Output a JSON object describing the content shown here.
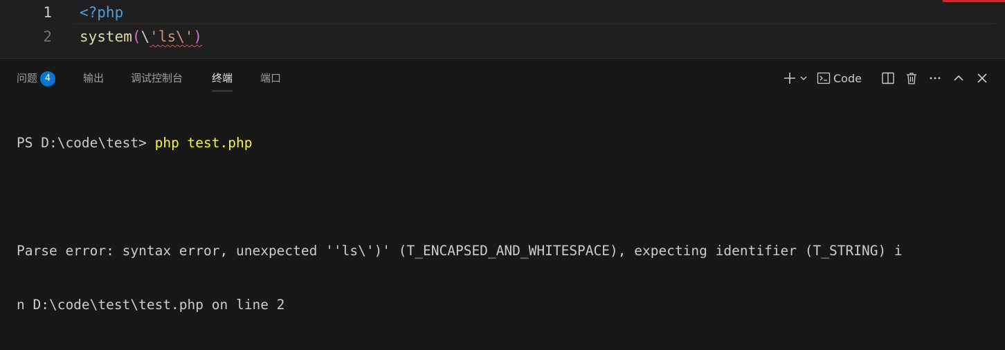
{
  "editor": {
    "lines": [
      {
        "number": "1",
        "tokens": {
          "tag": "<?php"
        }
      },
      {
        "number": "2",
        "tokens": {
          "fn": "system",
          "open_paren": "(",
          "backslash": "\\",
          "str": "'ls\\'",
          "close_paren": ")"
        }
      }
    ],
    "error_color": "#f14c4c"
  },
  "panel": {
    "tabs": [
      {
        "label": "问题",
        "badge": "4"
      },
      {
        "label": "输出"
      },
      {
        "label": "调试控制台"
      },
      {
        "label": "终端",
        "active": true
      },
      {
        "label": "端口"
      }
    ],
    "actions": {
      "new_terminal_icon": "plus-icon",
      "dropdown_icon": "chevron-down-icon",
      "terminal_icon": "terminal-icon",
      "terminal_label": "Code",
      "split_icon": "split-panel-icon",
      "delete_icon": "trash-icon",
      "more_icon": "ellipsis-icon",
      "maximize_icon": "chevron-up-icon",
      "close_icon": "close-icon"
    }
  },
  "terminal": {
    "prompt": "PS D:\\code\\test> ",
    "command": "php test.php",
    "error_line_1": "Parse error: syntax error, unexpected ''ls\\')' (T_ENCAPSED_AND_WHITESPACE), expecting identifier (T_STRING) i",
    "error_line_2": "n D:\\code\\test\\test.php on line 2"
  },
  "colors": {
    "accent": "#0078d4",
    "keyword": "#569cd6",
    "function": "#dcdcaa",
    "string": "#ce9178",
    "command": "#f5f543"
  }
}
